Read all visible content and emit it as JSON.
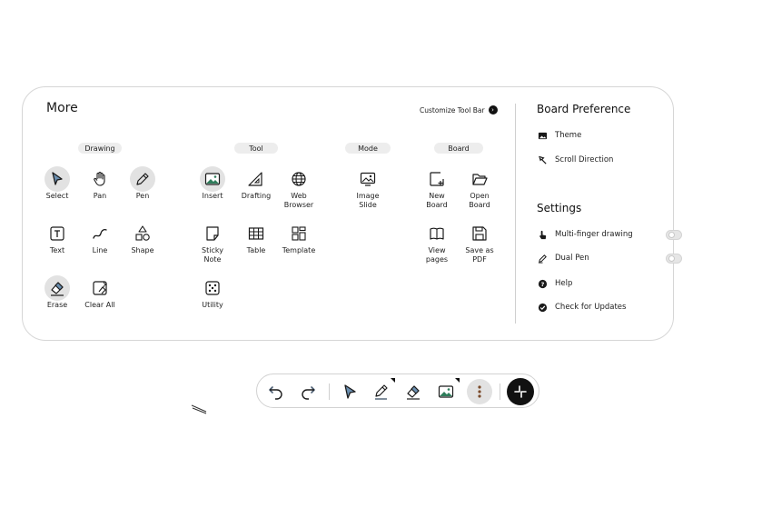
{
  "panel": {
    "title": "More",
    "customize_label": "Customize Tool Bar",
    "categories": [
      "Drawing",
      "Tool",
      "Mode",
      "Board"
    ],
    "tools": {
      "select": "Select",
      "pan": "Pan",
      "pen": "Pen",
      "text": "Text",
      "line": "Line",
      "shape": "Shape",
      "erase": "Erase",
      "clear_all": "Clear All",
      "insert": "Insert",
      "drafting": "Drafting",
      "web_browser": "Web Browser",
      "sticky_note": "Sticky Note",
      "table": "Table",
      "template": "Template",
      "utility": "Utility",
      "image_slide": "Image Slide",
      "new_board": "New Board",
      "open_board": "Open Board",
      "view_pages": "View pages",
      "save_as_pdf": "Save as PDF"
    }
  },
  "board_preference": {
    "title": "Board Preference",
    "items": [
      "Theme",
      "Scroll Direction"
    ]
  },
  "settings": {
    "title": "Settings",
    "multi_finger": "Multi-finger drawing",
    "dual_pen": "Dual Pen",
    "help": "Help",
    "updates": "Check for Updates"
  },
  "colors": {
    "accent_arrow": "#4a5d72",
    "selected_bg": "#e2e2e2",
    "pen_green": "#2e7d5b"
  }
}
